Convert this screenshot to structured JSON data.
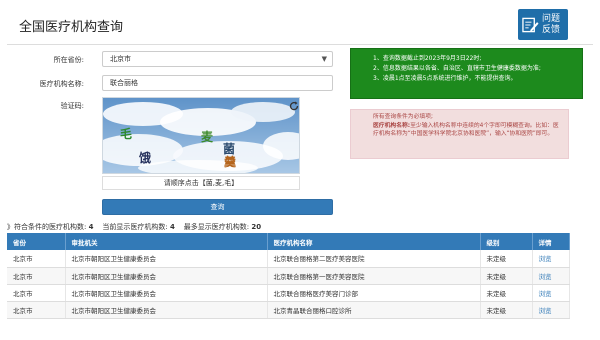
{
  "header": {
    "title": "全国医疗机构查询",
    "feedback_line1": "问题",
    "feedback_line2": "反馈",
    "feedback_icon": "edit-icon"
  },
  "form": {
    "province_label": "所在省份:",
    "province_value": "北京市",
    "institution_label": "医疗机构名称:",
    "institution_value": "联合丽格",
    "captcha_label": "验证码:",
    "captcha_chars": [
      "毛",
      "饿",
      "麦",
      "菌",
      "羹"
    ],
    "captcha_hint": "请顺序点击【菌,麦,毛】",
    "submit_label": "查询"
  },
  "notice_green": {
    "items": [
      "1、查询数据截止到2023年9月3日22时;",
      "2、信息数据结果以各省、自治区、直辖市卫生健康委数据为准;",
      "3、凌晨1点至凌晨5点系统进行维护，不能提供查询。"
    ]
  },
  "notice_red": {
    "line1": "所有查询条件为必填项;",
    "label": "医疗机构名称:",
    "line2": "至少输入机构名称中连续的4个字即可模糊查询。比如：医疗机构名称为“中国医学科学院北京协和医院”，输入“协和医院”即可。"
  },
  "results": {
    "summary_prefix": "》符合条件的医疗机构数:",
    "matched_count": "4",
    "current_label": "当前显示医疗机构数:",
    "current_count": "4",
    "max_label": "最多显示医疗机构数:",
    "max_count": "20",
    "columns": [
      "省份",
      "审批机关",
      "医疗机构名称",
      "级别",
      "详情"
    ],
    "rows": [
      [
        "北京市",
        "北京市朝阳区卫生健康委员会",
        "北京联合丽格第二医疗美容医院",
        "未定级",
        "浏览"
      ],
      [
        "北京市",
        "北京市朝阳区卫生健康委员会",
        "北京联合丽格第一医疗美容医院",
        "未定级",
        "浏览"
      ],
      [
        "北京市",
        "北京市朝阳区卫生健康委员会",
        "北京联合丽格医疗美容门诊部",
        "未定级",
        "浏览"
      ],
      [
        "北京市",
        "北京市朝阳区卫生健康委员会",
        "北京青晶联合丽格口腔诊所",
        "未定级",
        "浏览"
      ]
    ]
  },
  "colors": {
    "primary": "#337ab7",
    "notice_green": "#1d8a1d",
    "notice_red_bg": "#f2dede",
    "notice_red_text": "#a94442"
  }
}
